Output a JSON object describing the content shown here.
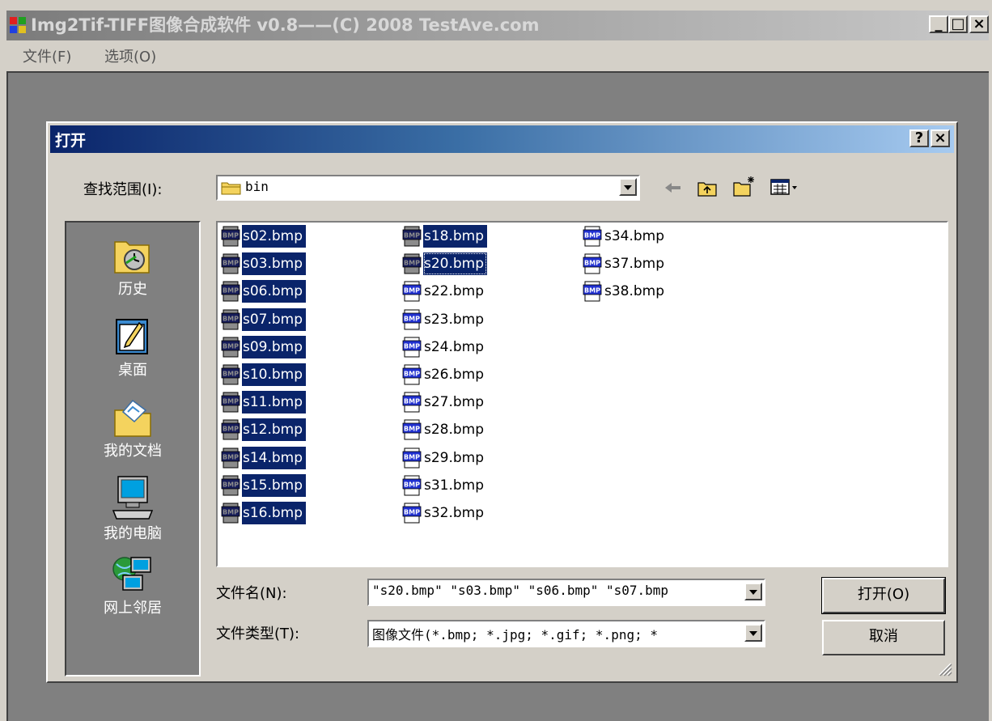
{
  "app": {
    "title": "Img2Tif-TIFF图像合成软件 v0.8——(C) 2008 TestAve.com",
    "minimize": "_",
    "maximize": "□",
    "close": "×",
    "menu": [
      "文件(F)",
      "选项(O)"
    ]
  },
  "dialog": {
    "title": "打开",
    "help": "?",
    "close": "×",
    "lookin_label": "查找范围(I):",
    "lookin_value": "bin",
    "places": [
      "历史",
      "桌面",
      "我的文档",
      "我的电脑",
      "网上邻居"
    ],
    "files": [
      {
        "name": "s02.bmp",
        "selected": true
      },
      {
        "name": "s03.bmp",
        "selected": true
      },
      {
        "name": "s06.bmp",
        "selected": true
      },
      {
        "name": "s07.bmp",
        "selected": true
      },
      {
        "name": "s09.bmp",
        "selected": true
      },
      {
        "name": "s10.bmp",
        "selected": true
      },
      {
        "name": "s11.bmp",
        "selected": true
      },
      {
        "name": "s12.bmp",
        "selected": true
      },
      {
        "name": "s14.bmp",
        "selected": true
      },
      {
        "name": "s15.bmp",
        "selected": true
      },
      {
        "name": "s16.bmp",
        "selected": true
      },
      {
        "name": "s18.bmp",
        "selected": true
      },
      {
        "name": "s20.bmp",
        "selected": true,
        "focused": true
      },
      {
        "name": "s22.bmp",
        "selected": false
      },
      {
        "name": "s23.bmp",
        "selected": false
      },
      {
        "name": "s24.bmp",
        "selected": false
      },
      {
        "name": "s26.bmp",
        "selected": false
      },
      {
        "name": "s27.bmp",
        "selected": false
      },
      {
        "name": "s28.bmp",
        "selected": false
      },
      {
        "name": "s29.bmp",
        "selected": false
      },
      {
        "name": "s31.bmp",
        "selected": false
      },
      {
        "name": "s32.bmp",
        "selected": false
      },
      {
        "name": "s34.bmp",
        "selected": false
      },
      {
        "name": "s37.bmp",
        "selected": false
      },
      {
        "name": "s38.bmp",
        "selected": false
      }
    ],
    "filename_label": "文件名(N):",
    "filename_value": "\"s20.bmp\" \"s03.bmp\" \"s06.bmp\" \"s07.bmp",
    "filetype_label": "文件类型(T):",
    "filetype_value": "图像文件(*.bmp; *.jpg; *.gif; *.png; *",
    "open_button": "打开(O)",
    "cancel_button": "取消"
  },
  "colors": {
    "selection": "#0a246a",
    "titlebar_active": "#0a246a",
    "face": "#d4d0c8"
  }
}
